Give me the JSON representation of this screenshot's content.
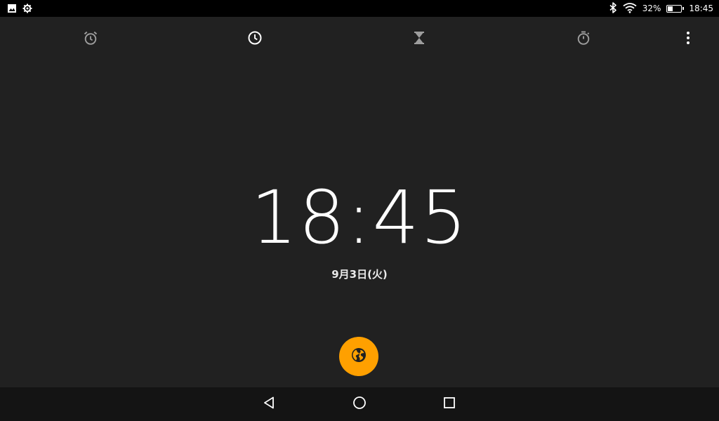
{
  "status_bar": {
    "battery_text": "32%",
    "battery_level": 0.32,
    "time": "18:45",
    "icons_left": [
      "image-icon",
      "settings-icon"
    ],
    "icons_right": [
      "bluetooth-icon",
      "wifi-icon",
      "battery-icon"
    ]
  },
  "tabs": [
    {
      "name": "alarm",
      "icon": "alarm-clock-icon",
      "selected": false
    },
    {
      "name": "clock",
      "icon": "clock-icon",
      "selected": true
    },
    {
      "name": "timer",
      "icon": "hourglass-icon",
      "selected": false
    },
    {
      "name": "stopwatch",
      "icon": "stopwatch-icon",
      "selected": false
    }
  ],
  "clock": {
    "time": "18:45",
    "date": "9月3日(火)"
  },
  "fab": {
    "icon": "globe-icon",
    "color": "#ffa000"
  },
  "nav": [
    "back-icon",
    "home-icon",
    "recents-icon"
  ],
  "colors": {
    "background": "#212121",
    "status_bar": "#000000",
    "nav_bar": "#141414",
    "accent": "#ffa000"
  }
}
